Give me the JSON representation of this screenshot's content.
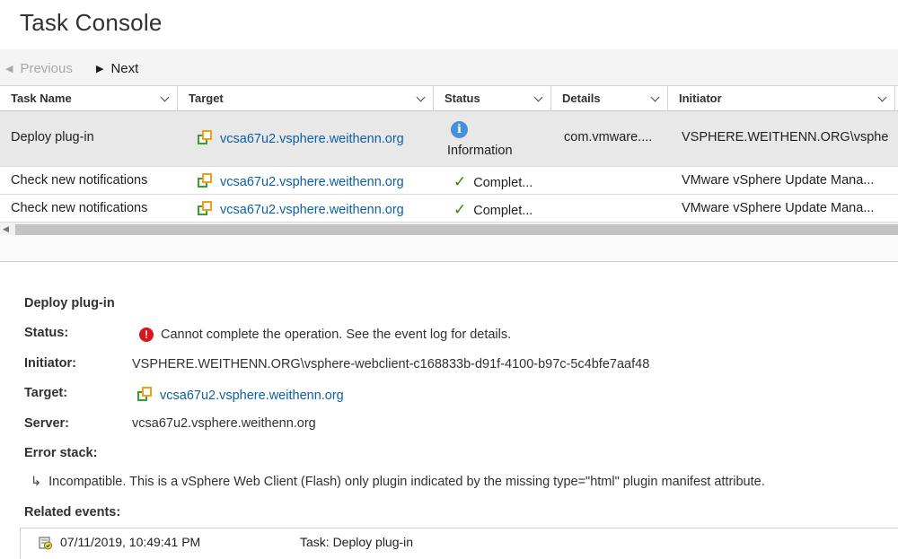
{
  "header": {
    "title": "Task Console"
  },
  "toolbar": {
    "previous_label": "Previous",
    "next_label": "Next"
  },
  "grid": {
    "columns": [
      "Task Name",
      "Target",
      "Status",
      "Details",
      "Initiator"
    ],
    "rows": [
      {
        "task_name": "Deploy plug-in",
        "target": "vcsa67u2.vsphere.weithenn.org",
        "status": "Information",
        "details": "com.vmware....",
        "initiator": "VSPHERE.WEITHENN.ORG\\vsphe"
      },
      {
        "task_name": "Check new notifications",
        "target": "vcsa67u2.vsphere.weithenn.org",
        "status": "Complet...",
        "details": "",
        "initiator": "VMware vSphere Update Mana..."
      },
      {
        "task_name": "Check new notifications",
        "target": "vcsa67u2.vsphere.weithenn.org",
        "status": "Complet...",
        "details": "",
        "initiator": "VMware vSphere Update Mana..."
      }
    ]
  },
  "detail": {
    "title": "Deploy plug-in",
    "status_label": "Status:",
    "status_value": "Cannot complete the operation. See the event log for details.",
    "initiator_label": "Initiator:",
    "initiator_value": "VSPHERE.WEITHENN.ORG\\vsphere-webclient-c168833b-d91f-4100-b97c-5c4bfe7aaf48",
    "target_label": "Target:",
    "target_value": "vcsa67u2.vsphere.weithenn.org",
    "server_label": "Server:",
    "server_value": "vcsa67u2.vsphere.weithenn.org",
    "error_stack_label": "Error stack:",
    "error_stack_value": "Incompatible. This is a vSphere Web Client (Flash) only plugin indicated by the missing type=\"html\" plugin manifest attribute.",
    "related_events_label": "Related events:",
    "events": [
      {
        "time": "07/11/2019, 10:49:41 PM",
        "description": "Task: Deploy plug-in"
      }
    ]
  },
  "colors": {
    "link": "#0b5fa5",
    "success": "#318700",
    "error": "#d8161c",
    "info": "#4a90d9"
  }
}
